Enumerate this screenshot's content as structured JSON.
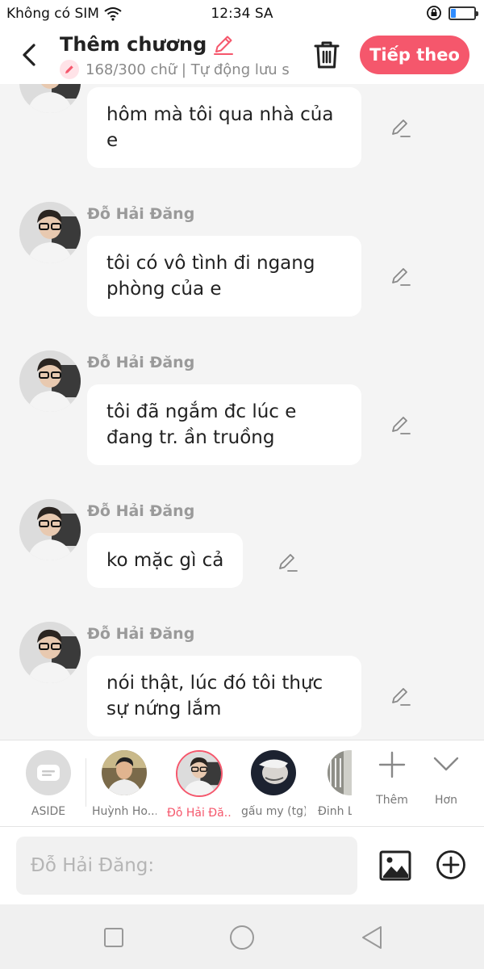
{
  "status_bar": {
    "carrier": "Không có SIM",
    "time": "12:34 SA",
    "battery_level": 0.2,
    "colors": {
      "battery": "#2f8cff"
    }
  },
  "header": {
    "title": "Thêm chương",
    "subtitle": "168/300 chữ | Tự động lưu s",
    "next_label": "Tiếp theo",
    "icons": [
      "back-arrow-icon",
      "pencil-icon",
      "trash-icon"
    ],
    "colors": {
      "accent": "#f5576c"
    }
  },
  "messages": [
    {
      "sender": "",
      "text": "hôm mà tôi qua nhà của e"
    },
    {
      "sender": "Đỗ Hải Đăng",
      "text": "tôi có vô tình đi ngang phòng của e"
    },
    {
      "sender": "Đỗ Hải Đăng",
      "text": "tôi đã ngắm đc lúc e đang tr. ần truồng"
    },
    {
      "sender": "Đỗ Hải Đăng",
      "text": "ko mặc gì cả"
    },
    {
      "sender": "Đỗ Hải Đăng",
      "text": "nói thật, lúc đó tôi thực sự nứng lắm"
    }
  ],
  "characters": [
    {
      "name": "ASIDE",
      "type": "aside",
      "active": false
    },
    {
      "name": "Huỳnh Ho...",
      "active": false
    },
    {
      "name": "Đỗ Hải Đă...",
      "active": true
    },
    {
      "name": "gấu my (tg)",
      "active": false
    },
    {
      "name": "Đinh L",
      "active": false
    }
  ],
  "tools": {
    "more_label": "Thêm",
    "expand_label": "Hơn"
  },
  "input": {
    "placeholder": "Đỗ Hải Đăng:"
  },
  "nav": {
    "icons": [
      "square-icon",
      "circle-icon",
      "triangle-back-icon"
    ]
  }
}
